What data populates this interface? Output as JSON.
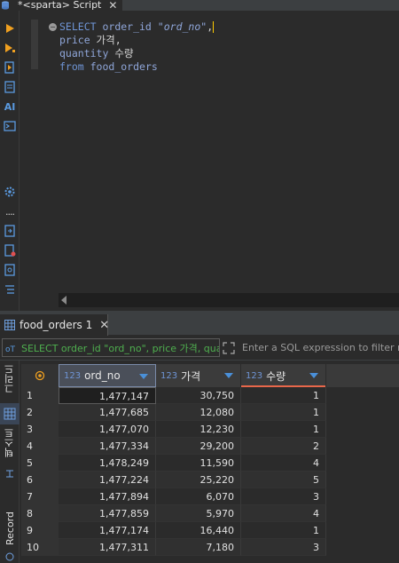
{
  "editor": {
    "tab_title": "*<sparta> Script",
    "tab_close": "✕",
    "fold_marker": "−",
    "code": {
      "l1_kw": "SELECT",
      "l1_id": " order_id ",
      "l1_str": "\"ord_no\"",
      "l1_tail": ",",
      "l2_id": "price",
      "l2_alias": " 가격,",
      "l3_id": "quantity",
      "l3_alias": " 수량",
      "l4_kw": "from",
      "l4_id": " food_orders"
    }
  },
  "left_toolbar": {
    "icons": [
      "run-statement-icon",
      "run-script-icon",
      "explain-plan-icon",
      "script-doc-icon",
      "ai-icon",
      "terminal-icon",
      "settings-icon",
      "more-icon",
      "export-icon",
      "load-icon",
      "format-icon",
      "outline-icon"
    ],
    "ai_label": "AI",
    "more_label": "...."
  },
  "results": {
    "tab_label": "food_orders 1",
    "tab_close": "✕",
    "filter_sql": "SELECT order_id \"ord_no\", price 가격, quantity 수량 from food_orders",
    "filter_placeholder": "Enter a SQL expression to filter results"
  },
  "side_tabs": {
    "grid_label": "그리드",
    "text_label": "텍스트",
    "record_label": "Record"
  },
  "grid": {
    "columns": [
      {
        "type": "123",
        "name": "ord_no"
      },
      {
        "type": "123",
        "name": "가격"
      },
      {
        "type": "123",
        "name": "수량"
      }
    ],
    "rows": [
      {
        "n": "1",
        "ord_no": "1,477,147",
        "price": "30,750",
        "qty": "1"
      },
      {
        "n": "2",
        "ord_no": "1,477,685",
        "price": "12,080",
        "qty": "1"
      },
      {
        "n": "3",
        "ord_no": "1,477,070",
        "price": "12,230",
        "qty": "1"
      },
      {
        "n": "4",
        "ord_no": "1,477,334",
        "price": "29,200",
        "qty": "2"
      },
      {
        "n": "5",
        "ord_no": "1,478,249",
        "price": "11,590",
        "qty": "4"
      },
      {
        "n": "6",
        "ord_no": "1,477,224",
        "price": "25,220",
        "qty": "5"
      },
      {
        "n": "7",
        "ord_no": "1,477,894",
        "price": "6,070",
        "qty": "3"
      },
      {
        "n": "8",
        "ord_no": "1,477,859",
        "price": "5,970",
        "qty": "4"
      },
      {
        "n": "9",
        "ord_no": "1,477,174",
        "price": "16,440",
        "qty": "1"
      },
      {
        "n": "10",
        "ord_no": "1,477,311",
        "price": "7,180",
        "qty": "3"
      }
    ]
  },
  "colors": {
    "keyword": "#6f95d6",
    "sql_filter_text": "#4fb04f",
    "sort_accent": "#4a90d9",
    "active_column_underline": "#e8674a",
    "run_icon": "#f0a020"
  }
}
